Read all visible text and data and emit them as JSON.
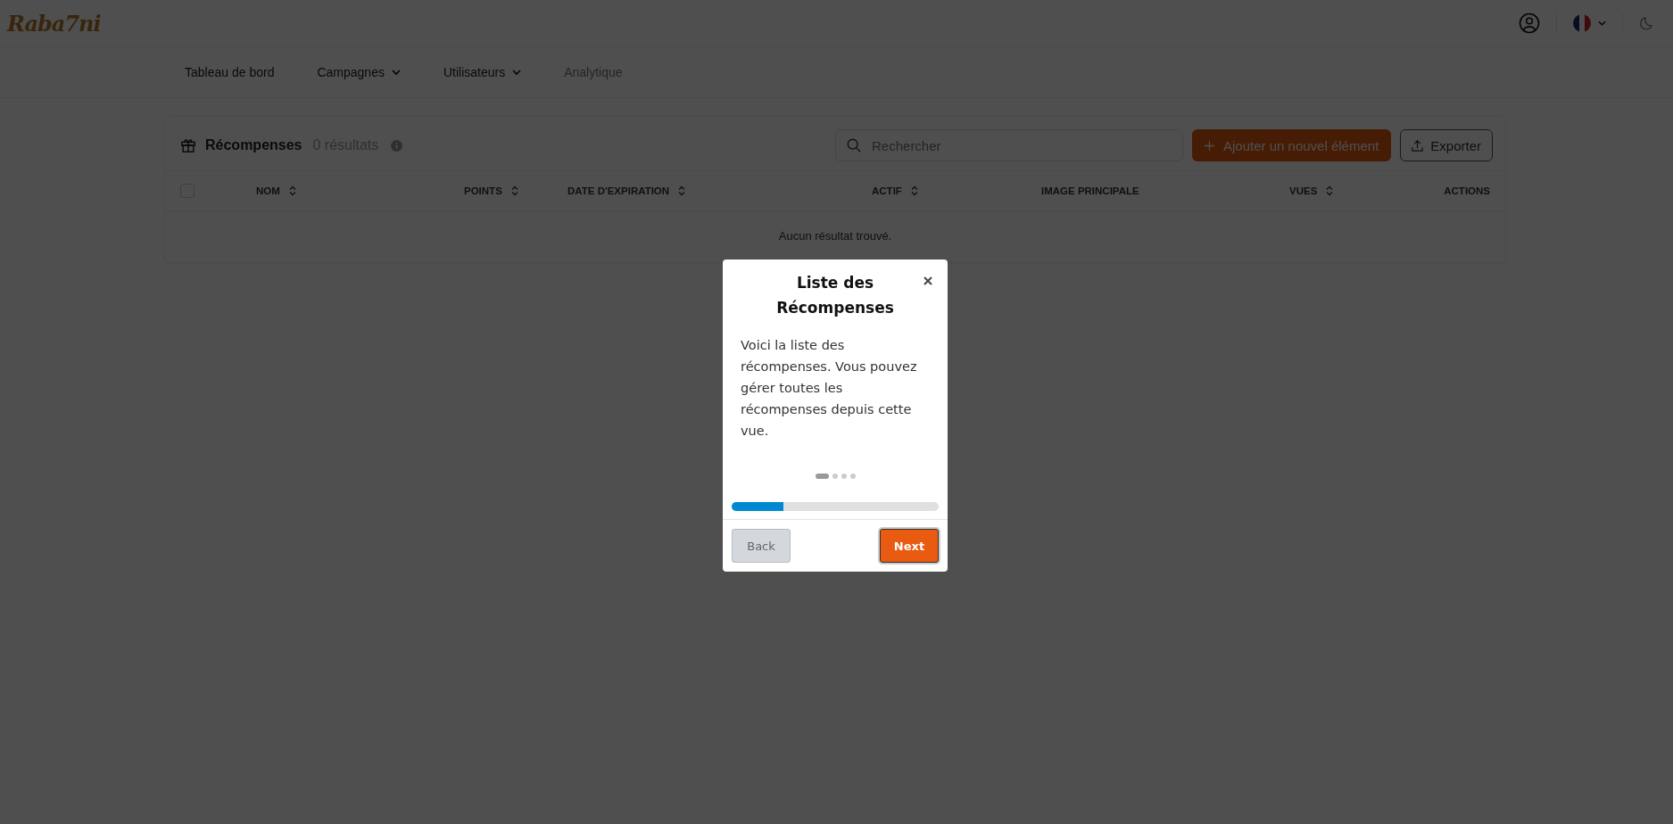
{
  "header": {
    "logo": "Raba7ni"
  },
  "nav": [
    {
      "label": "Tableau de bord",
      "dropdown": false,
      "disabled": false
    },
    {
      "label": "Campagnes",
      "dropdown": true,
      "disabled": false
    },
    {
      "label": "Utilisateurs",
      "dropdown": true,
      "disabled": false
    },
    {
      "label": "Analytique",
      "dropdown": false,
      "disabled": true
    }
  ],
  "card": {
    "title": "Récompenses",
    "count": "0 résultats",
    "search": {
      "placeholder": "Rechercher"
    },
    "add_button": "Ajouter un nouvel élément",
    "export_button": "Exporter",
    "select_all": {
      "checked": false
    },
    "columns": [
      {
        "label": "NOM",
        "sortable": true
      },
      {
        "label": "POINTS",
        "sortable": true
      },
      {
        "label": "DATE D'EXPIRATION",
        "sortable": true
      },
      {
        "label": "ACTIF",
        "sortable": true
      },
      {
        "label": "IMAGE PRINCIPALE",
        "sortable": false
      },
      {
        "label": "VUES",
        "sortable": true
      },
      {
        "label": "ACTIONS",
        "sortable": false
      }
    ],
    "empty": "Aucun résultat trouvé."
  },
  "tour": {
    "title": "Liste des Récompenses",
    "body": "Voici la liste des récompenses. Vous pouvez gérer toutes les récompenses depuis cette vue.",
    "steps": [
      {
        "selected": true
      },
      {
        "selected": false
      },
      {
        "selected": false
      },
      {
        "selected": false
      }
    ],
    "level": 0.25,
    "back": {
      "label": "Back",
      "disabled": true
    },
    "next": "Next"
  }
}
